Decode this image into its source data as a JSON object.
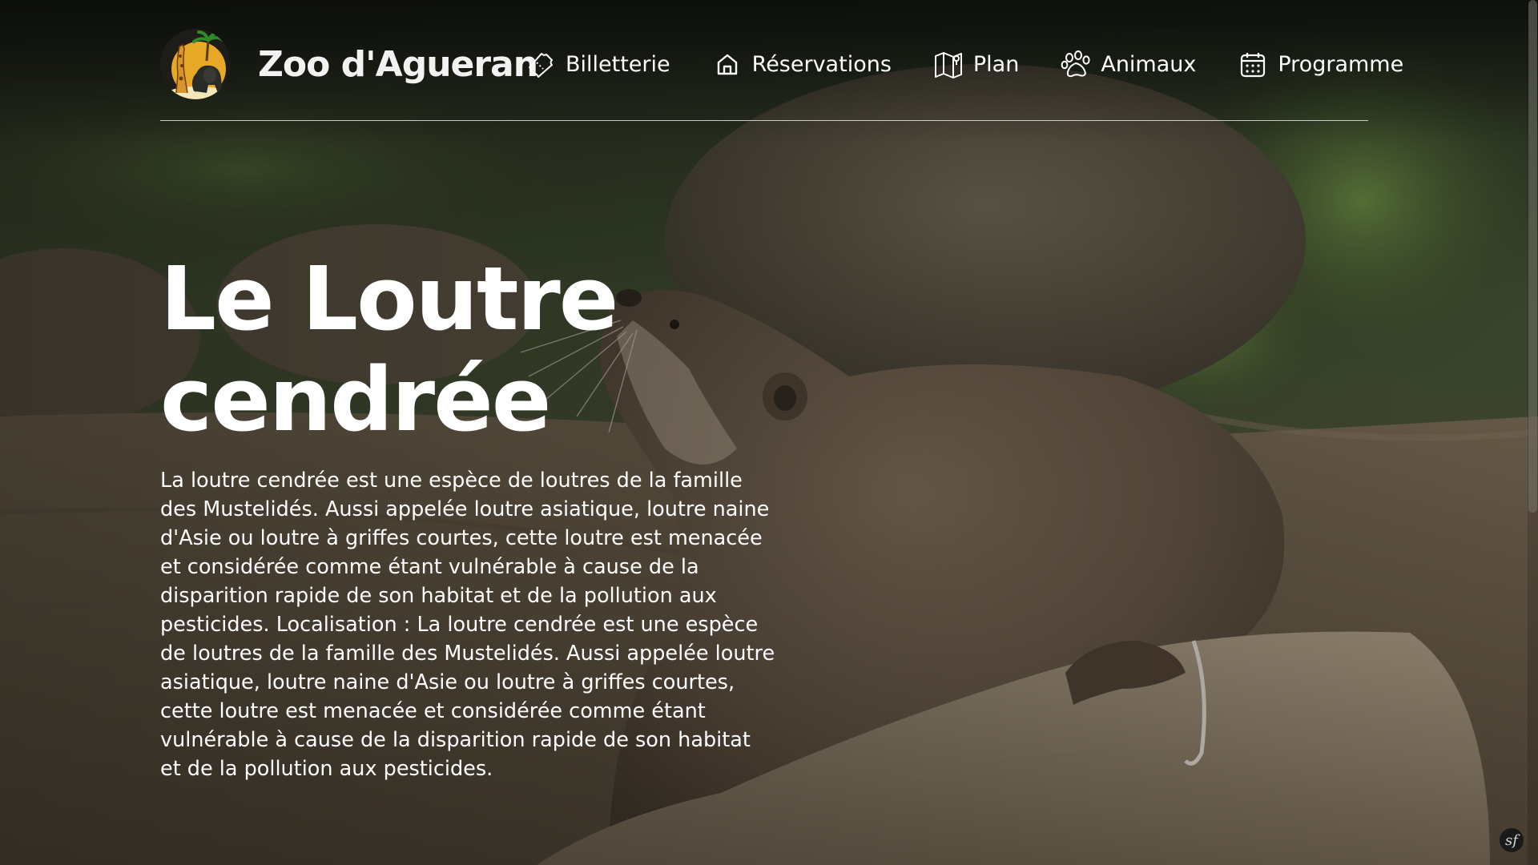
{
  "site": {
    "name": "Zoo d'Agueran",
    "logo_icon": "zoo-logo-giraffe-elephant"
  },
  "nav": {
    "items": [
      {
        "label": "Billetterie",
        "icon": "ticket-icon"
      },
      {
        "label": "Réservations",
        "icon": "home-icon"
      },
      {
        "label": "Plan",
        "icon": "map-icon"
      },
      {
        "label": "Animaux",
        "icon": "paw-icon"
      },
      {
        "label": "Programme",
        "icon": "calendar-icon"
      }
    ]
  },
  "hero": {
    "title": "Le Loutre cendrée",
    "description": "La loutre cendrée est une espèce de loutres de la famille des Mustelidés. Aussi appelée loutre asiatique, loutre naine d'Asie ou loutre à griffes courtes, cette loutre est menacée et considérée comme étant vulnérable à cause de la disparition rapide de son habitat et de la pollution aux pesticides. Localisation : La loutre cendrée est une espèce de loutres de la famille des Mustelidés. Aussi appelée loutre asiatique, loutre naine d'Asie ou loutre à griffes courtes, cette loutre est menacée et considérée comme étant vulnérable à cause de la disparition rapide de son habitat et de la pollution aux pesticides.",
    "background_subject": "otter-on-rock-photo"
  },
  "colors": {
    "text": "#ffffff",
    "logo_sun": "#e8a928",
    "header_rule": "#d9d9d9"
  }
}
